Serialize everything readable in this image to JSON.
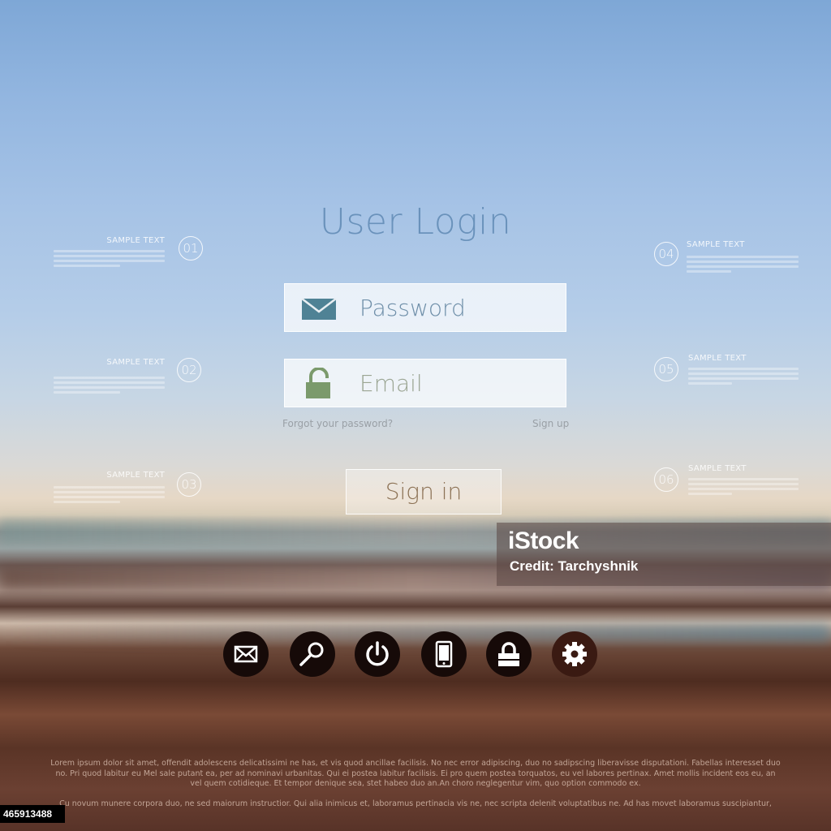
{
  "login": {
    "title": "User Login",
    "field_1_label": "Password",
    "field_2_label": "Email",
    "forgot_link": "Forgot your password?",
    "signup_link": "Sign up",
    "signin_button": "Sign in"
  },
  "side_items": [
    {
      "number": "01",
      "heading": "SAMPLE TEXT"
    },
    {
      "number": "02",
      "heading": "SAMPLE TEXT"
    },
    {
      "number": "03",
      "heading": "SAMPLE TEXT"
    },
    {
      "number": "04",
      "heading": "SAMPLE TEXT"
    },
    {
      "number": "05",
      "heading": "SAMPLE TEXT"
    },
    {
      "number": "06",
      "heading": "SAMPLE TEXT"
    }
  ],
  "icon_bar": [
    {
      "icon": "mail-icon"
    },
    {
      "icon": "search-icon"
    },
    {
      "icon": "power-icon"
    },
    {
      "icon": "mobile-icon"
    },
    {
      "icon": "lock-icon"
    },
    {
      "icon": "gear-icon"
    }
  ],
  "footer": {
    "paragraph_1": "Lorem ipsum dolor sit amet, offendit adolescens delicatissimi ne has, et vis quod ancillae facilisis. No nec error adipiscing, duo no sadipscing liberavisse disputationi. Fabellas interesset duo no. Pri quod labitur eu Mel sale putant ea, per ad nominavi urbanitas. Qui ei postea labitur facilisis. Ei pro quem postea torquatos, eu vel labores pertinax. Amet mollis incident eos eu, an vel quem cotidieque. Et tempor denique sea, stet habeo duo an.An choro neglegentur vim, quo option commodo ex.",
    "paragraph_2": "Cu novum munere corpora duo, ne sed maiorum instructior. Qui alia inimicus et, laboramus pertinacia vis ne, nec scripta delenit voluptatibus ne. Ad has movet laboramus suscipiantur,"
  },
  "watermark": {
    "brand": "iStock",
    "credit": "Credit: Tarchyshnik",
    "stock_id": "465913488"
  },
  "colors": {
    "title": "#6a92bb",
    "mail_icon": "#4f8295",
    "lock_icon": "#7b9a6c",
    "signin_text": "#8c7255",
    "icon_button_bg": "#160a08"
  }
}
